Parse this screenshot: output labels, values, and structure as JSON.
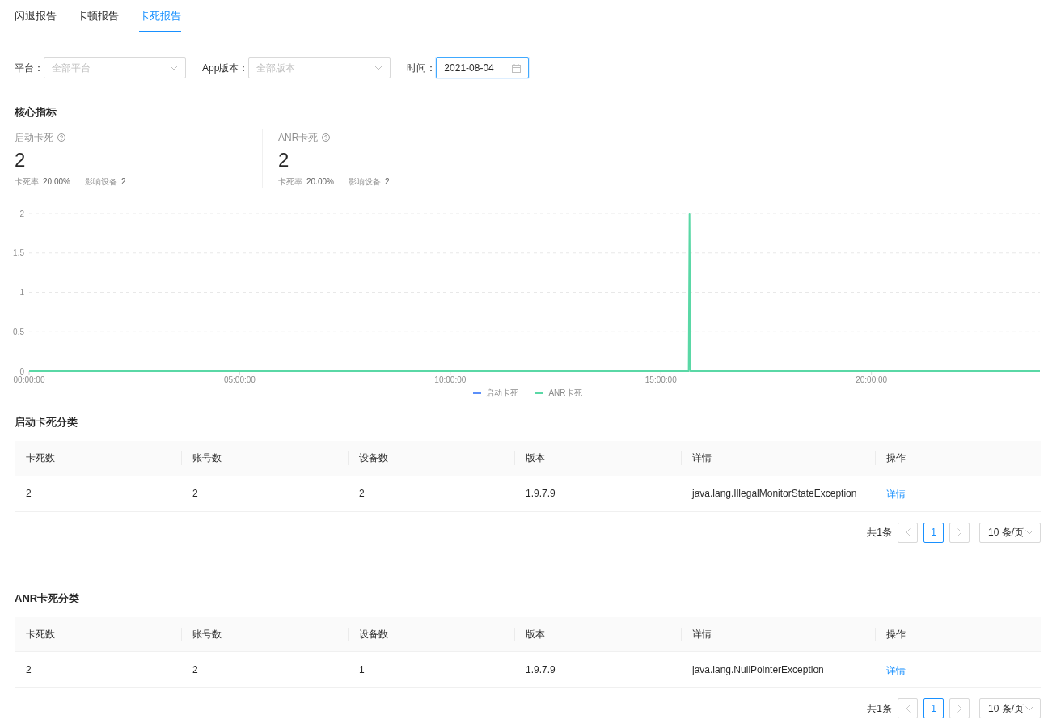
{
  "tabs": [
    {
      "label": "闪退报告",
      "selected": false
    },
    {
      "label": "卡顿报告",
      "selected": false
    },
    {
      "label": "卡死报告",
      "selected": true
    }
  ],
  "filters": [
    {
      "label": "平台：",
      "kind": "select",
      "placeholder": "全部平台",
      "focused": false
    },
    {
      "label": "App版本：",
      "kind": "select",
      "placeholder": "全部版本",
      "focused": false
    },
    {
      "label": "时间：",
      "kind": "date",
      "value": "2021-08-04",
      "focused": true
    }
  ],
  "core_metrics": {
    "title": "核心指标",
    "cards": [
      {
        "label": "启动卡死",
        "value": "2",
        "stats": [
          {
            "label": "卡死率",
            "value": "20.00%"
          },
          {
            "label": "影响设备",
            "value": "2"
          }
        ]
      },
      {
        "label": "ANR卡死",
        "value": "2",
        "stats": [
          {
            "label": "卡死率",
            "value": "20.00%"
          },
          {
            "label": "影响设备",
            "value": "2"
          }
        ]
      }
    ]
  },
  "chart": {
    "chart_data": {
      "type": "line",
      "grid": true,
      "x": [
        0,
        15.66,
        15.68,
        15.7,
        24
      ],
      "xlim": [
        0,
        24
      ],
      "ylim": [
        0,
        2
      ],
      "xticks": [
        {
          "value": 0,
          "label": "00:00:00"
        },
        {
          "value": 5,
          "label": "05:00:00"
        },
        {
          "value": 10,
          "label": "10:00:00"
        },
        {
          "value": 15,
          "label": "15:00:00"
        },
        {
          "value": 20,
          "label": "20:00:00"
        }
      ],
      "yticks": [
        0,
        0.5,
        1,
        1.5,
        2
      ],
      "series": [
        {
          "name": "启动卡死",
          "color": "#5b8ff9",
          "values": [
            null,
            null,
            null,
            null,
            null
          ]
        },
        {
          "name": "ANR卡死",
          "color": "#5ad8a6",
          "values": [
            0,
            0,
            2,
            0,
            0
          ]
        }
      ]
    }
  },
  "tables": [
    {
      "title": "启动卡死分类",
      "columns": [
        "卡死数",
        "账号数",
        "设备数",
        "版本",
        "详情",
        "操作"
      ],
      "rows": [
        {
          "cells": [
            "2",
            "2",
            "2",
            "1.9.7.9",
            "java.lang.IllegalMonitorStateException"
          ],
          "action": "详情"
        }
      ],
      "pagination": {
        "total": "共1条",
        "prev_disabled": true,
        "pages": [
          {
            "label": "1",
            "selected": true
          }
        ],
        "next_disabled": true,
        "page_size": "10 条/页"
      }
    },
    {
      "title": "ANR卡死分类",
      "columns": [
        "卡死数",
        "账号数",
        "设备数",
        "版本",
        "详情",
        "操作"
      ],
      "rows": [
        {
          "cells": [
            "2",
            "2",
            "1",
            "1.9.7.9",
            "java.lang.NullPointerException"
          ],
          "action": "详情"
        }
      ],
      "pagination": {
        "total": "共1条",
        "prev_disabled": true,
        "pages": [
          {
            "label": "1",
            "selected": true
          }
        ],
        "next_disabled": true,
        "page_size": "10 条/页"
      }
    }
  ]
}
